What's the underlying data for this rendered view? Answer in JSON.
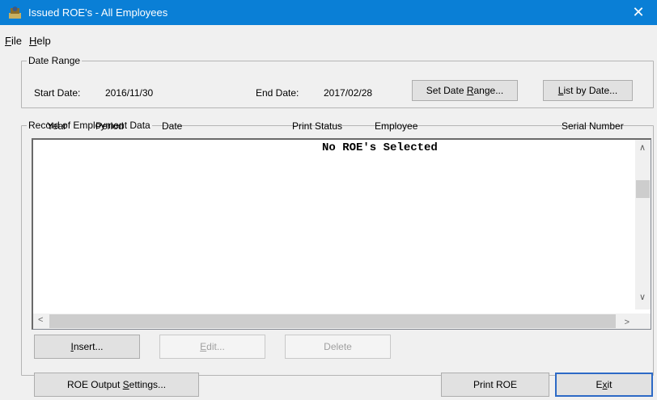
{
  "window": {
    "title": "Issued ROE's - All Employees",
    "close_glyph": "✕"
  },
  "menu": [
    {
      "label": "File",
      "accel": "F",
      "rest": "ile"
    },
    {
      "label": "Help",
      "accel": "H",
      "rest": "elp"
    }
  ],
  "date_range": {
    "group_label": "Date Range",
    "start_label": "Start Date:",
    "start_value": "2016/11/30",
    "end_label": "End Date:",
    "end_value": "2017/02/28",
    "set_button": {
      "pre": "Set Date ",
      "accel": "R",
      "post": "ange..."
    },
    "list_button": {
      "pre": "",
      "accel": "L",
      "post": "ist by Date..."
    }
  },
  "roe_data": {
    "group_label": "Record of Employment Data",
    "columns": [
      "Year",
      "Period",
      "Date",
      "Print Status",
      "Employee",
      "Serial Number"
    ],
    "empty_message": "No ROE's Selected",
    "insert_button": {
      "pre": "",
      "accel": "I",
      "post": "nsert..."
    },
    "edit_button": {
      "pre": "",
      "accel": "E",
      "post": "dit..."
    },
    "delete_button": "Delete"
  },
  "footer": {
    "output_settings_button": {
      "pre": "ROE Output ",
      "accel": "S",
      "post": "ettings..."
    },
    "print_button": "Print ROE",
    "exit_button": {
      "pre": "E",
      "accel": "x",
      "post": "it"
    }
  },
  "icons": {
    "app": "roe-app-icon",
    "scroll_up": "▲",
    "scroll_down": "▼",
    "scroll_left": "<",
    "scroll_right": ">"
  },
  "colors": {
    "titlebar": "#0a7fd6",
    "window_bg": "#f0f0f0"
  }
}
